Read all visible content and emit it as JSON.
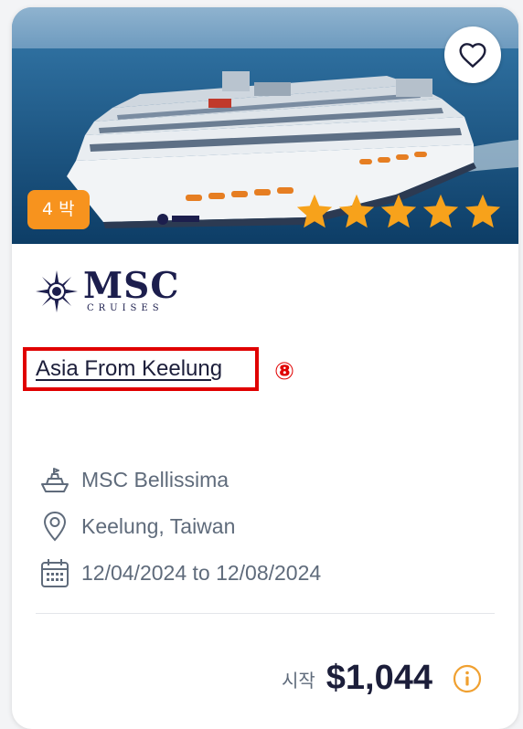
{
  "card": {
    "nights_badge": "4 박",
    "rating_stars": 5,
    "favorite_icon": "heart-outline-icon",
    "cruise_line_logo": {
      "main": "MSC",
      "sub": "CRUISES"
    },
    "title": "Asia From Keelung",
    "annotation_marker": "⑧",
    "details": {
      "ship": {
        "icon": "ship-icon",
        "text": "MSC Bellissima"
      },
      "port": {
        "icon": "location-pin-icon",
        "text": "Keelung, Taiwan"
      },
      "dates": {
        "icon": "calendar-icon",
        "text": "12/04/2024 to 12/08/2024"
      }
    },
    "price": {
      "prefix": "시작",
      "value": "$1,044",
      "info_icon": "info-icon"
    }
  },
  "colors": {
    "badge": "#f7931e",
    "star": "#f7a21b",
    "title_text": "#1c1e3a",
    "detail_text": "#5f6b7b",
    "highlight_box": "#e00000",
    "info_icon": "#f0a030",
    "logo": "#1c1e4d"
  }
}
